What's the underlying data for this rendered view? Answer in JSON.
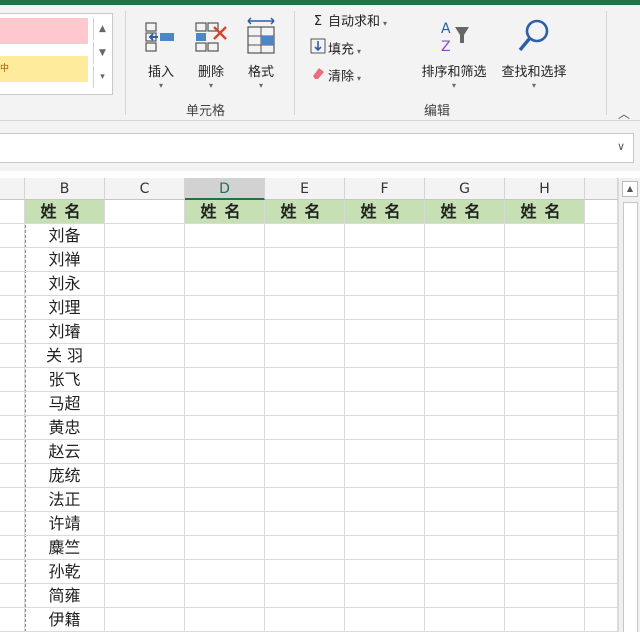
{
  "ribbon": {
    "cells_group": {
      "label": "单元格",
      "insert": "插入",
      "delete": "删除",
      "format": "格式"
    },
    "edit_group": {
      "label": "编辑",
      "autosum": "自动求和",
      "fill": "填充",
      "clear": "清除",
      "sort_filter": "排序和筛选",
      "find_select": "查找和选择"
    },
    "style_chip_text": "中"
  },
  "columns": [
    "B",
    "C",
    "D",
    "E",
    "F",
    "G",
    "H"
  ],
  "selected_column": "D",
  "header_text": "姓名",
  "names": [
    "刘备",
    "刘禅",
    "刘永",
    "刘理",
    "刘璿",
    "关 羽",
    "张飞",
    "马超",
    "黄忠",
    "赵云",
    "庞统",
    "法正",
    "许靖",
    "麋竺",
    "孙乾",
    "简雍",
    "伊籍"
  ],
  "colors": {
    "accent": "#217346",
    "header_fill": "#c6e0b4",
    "bad_style": "#ffc7ce",
    "neutral_style": "#ffeb9c"
  }
}
